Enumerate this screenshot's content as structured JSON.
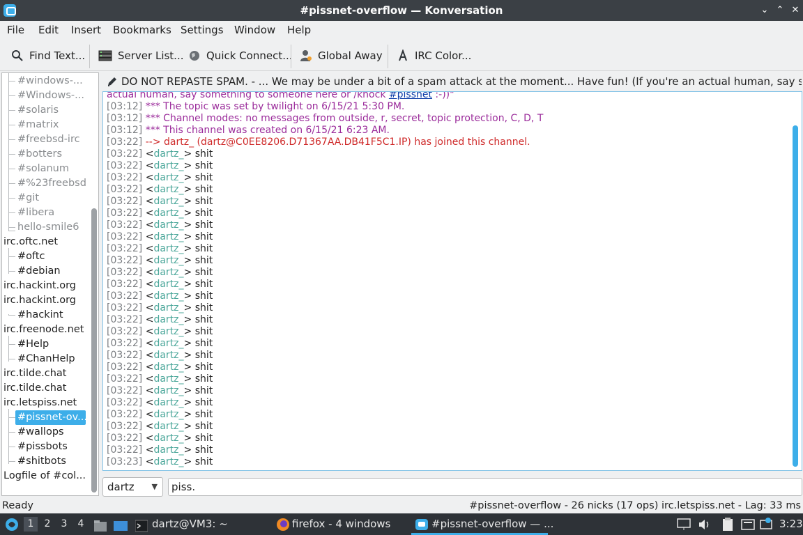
{
  "window": {
    "title": "#pissnet-overflow — Konversation",
    "controls": [
      "⌄",
      "⌃",
      "✕"
    ]
  },
  "menu": [
    "File",
    "Edit",
    "Insert",
    "Bookmarks",
    "Settings",
    "Window",
    "Help"
  ],
  "toolbar": {
    "find": "Find Text...",
    "server_list": "Server List...",
    "quick_connect": "Quick Connect...",
    "global_away": "Global Away",
    "irc_color": "IRC Color..."
  },
  "tree": {
    "items": [
      {
        "label": "#windows-...",
        "level": 1,
        "muted": true
      },
      {
        "label": "#Windows-...",
        "level": 1,
        "muted": true
      },
      {
        "label": "#solaris",
        "level": 1,
        "muted": true
      },
      {
        "label": "#matrix",
        "level": 1,
        "muted": true
      },
      {
        "label": "#freebsd-irc",
        "level": 1,
        "muted": true
      },
      {
        "label": "#botters",
        "level": 1,
        "muted": true
      },
      {
        "label": "#solanum",
        "level": 1,
        "muted": true
      },
      {
        "label": "#%23freebsd",
        "level": 1,
        "muted": true
      },
      {
        "label": "#git",
        "level": 1,
        "muted": true
      },
      {
        "label": "#libera",
        "level": 1,
        "muted": true
      },
      {
        "label": "hello-smile6",
        "level": 1,
        "muted": true
      },
      {
        "label": "irc.oftc.net",
        "level": 0,
        "muted": false
      },
      {
        "label": "#oftc",
        "level": 1,
        "muted": false
      },
      {
        "label": "#debian",
        "level": 1,
        "muted": false
      },
      {
        "label": "irc.hackint.org",
        "level": 0,
        "muted": false
      },
      {
        "label": "irc.hackint.org",
        "level": 0,
        "muted": false
      },
      {
        "label": "#hackint",
        "level": 1,
        "muted": false
      },
      {
        "label": "irc.freenode.net",
        "level": 0,
        "muted": false
      },
      {
        "label": "#Help",
        "level": 1,
        "muted": false
      },
      {
        "label": "#ChanHelp",
        "level": 1,
        "muted": false
      },
      {
        "label": "irc.tilde.chat",
        "level": 0,
        "muted": false
      },
      {
        "label": "irc.tilde.chat",
        "level": 0,
        "muted": false
      },
      {
        "label": "irc.letspiss.net",
        "level": 0,
        "muted": false
      },
      {
        "label": "#pissnet-ov...",
        "level": 1,
        "muted": false,
        "selected": true
      },
      {
        "label": "#wallops",
        "level": 1,
        "muted": false
      },
      {
        "label": "#pissbots",
        "level": 1,
        "muted": false
      },
      {
        "label": "#shitbots",
        "level": 1,
        "muted": false
      },
      {
        "label": "Logfile of #col...",
        "level": 0,
        "muted": false
      }
    ]
  },
  "topic": "DO NOT REPASTE SPAM. - ... We may be under a bit of a spam attack at the moment... Have fun! (If you're an actual human, say something to ...",
  "chat": {
    "partial_line": {
      "text": "actual human, say something to someone here or /knock ",
      "link": "#pissnet",
      "after": " :-))\""
    },
    "system_lines": [
      {
        "time": "[03:12]",
        "text": "*** The topic was set by twilight on 6/15/21 5:30 PM.",
        "kind": "sys"
      },
      {
        "time": "[03:12]",
        "text": "*** Channel modes: no messages from outside, r, secret, topic protection, C, D, T",
        "kind": "sys"
      },
      {
        "time": "[03:12]",
        "text": "*** This channel was created on 6/15/21 6:23 AM.",
        "kind": "sys"
      },
      {
        "time": "[03:22]",
        "text": "--> dartz_ (dartz@C0EE8206.D71367AA.DB41F5C1.IP) has joined this channel.",
        "kind": "join"
      }
    ],
    "messages": [
      {
        "time": "[03:22]",
        "nick": "dartz_",
        "text": "shit"
      },
      {
        "time": "[03:22]",
        "nick": "dartz_",
        "text": "shit"
      },
      {
        "time": "[03:22]",
        "nick": "dartz_",
        "text": "shit"
      },
      {
        "time": "[03:22]",
        "nick": "dartz_",
        "text": "shit"
      },
      {
        "time": "[03:22]",
        "nick": "dartz_",
        "text": "shit"
      },
      {
        "time": "[03:22]",
        "nick": "dartz_",
        "text": "shit"
      },
      {
        "time": "[03:22]",
        "nick": "dartz_",
        "text": "shit"
      },
      {
        "time": "[03:22]",
        "nick": "dartz_",
        "text": "shit"
      },
      {
        "time": "[03:22]",
        "nick": "dartz_",
        "text": "shit"
      },
      {
        "time": "[03:22]",
        "nick": "dartz_",
        "text": "shit"
      },
      {
        "time": "[03:22]",
        "nick": "dartz_",
        "text": "shit"
      },
      {
        "time": "[03:22]",
        "nick": "dartz_",
        "text": "shit"
      },
      {
        "time": "[03:22]",
        "nick": "dartz_",
        "text": "shit"
      },
      {
        "time": "[03:22]",
        "nick": "dartz_",
        "text": "shit"
      },
      {
        "time": "[03:22]",
        "nick": "dartz_",
        "text": "shit"
      },
      {
        "time": "[03:22]",
        "nick": "dartz_",
        "text": "shit"
      },
      {
        "time": "[03:22]",
        "nick": "dartz_",
        "text": "shit"
      },
      {
        "time": "[03:22]",
        "nick": "dartz_",
        "text": "shit"
      },
      {
        "time": "[03:22]",
        "nick": "dartz_",
        "text": "shit"
      },
      {
        "time": "[03:22]",
        "nick": "dartz_",
        "text": "shit"
      },
      {
        "time": "[03:22]",
        "nick": "dartz_",
        "text": "shit"
      },
      {
        "time": "[03:22]",
        "nick": "dartz_",
        "text": "shit"
      },
      {
        "time": "[03:22]",
        "nick": "dartz_",
        "text": "shit"
      },
      {
        "time": "[03:22]",
        "nick": "dartz_",
        "text": "shit"
      },
      {
        "time": "[03:22]",
        "nick": "dartz_",
        "text": "shit"
      },
      {
        "time": "[03:22]",
        "nick": "dartz_",
        "text": "shit"
      },
      {
        "time": "[03:23]",
        "nick": "dartz_",
        "text": "shit"
      }
    ]
  },
  "input": {
    "nick": "dartz",
    "text": "piss."
  },
  "status": {
    "left": "Ready",
    "right": "#pissnet-overflow - 26 nicks (17 ops)  irc.letspiss.net - Lag: 33 ms"
  },
  "taskbar": {
    "desktops": [
      "1",
      "2",
      "3",
      "4"
    ],
    "terminal": "dartz@VM3: ~",
    "firefox": "firefox - 4 windows",
    "konversation": "#pissnet-overflow — ...",
    "clock": "3:23"
  },
  "colors": {
    "accent": "#3daee9",
    "nick": "#4ba79a",
    "system": "#9b2c9b",
    "join": "#cf2a2a"
  }
}
